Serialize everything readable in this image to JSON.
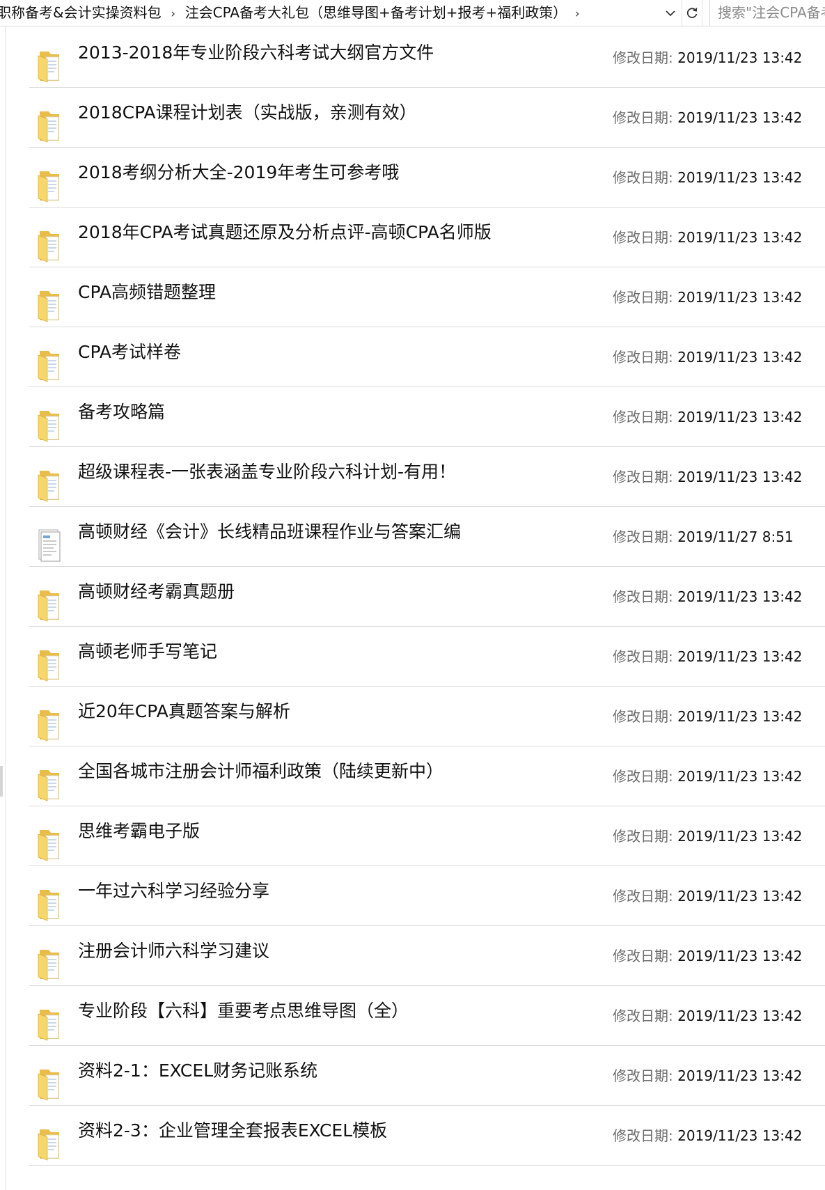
{
  "address_bar": {
    "breadcrumb": [
      "职称备考&会计实操资料包",
      "注会CPA备考大礼包（思维导图+备考计划+报考+福利政策）"
    ],
    "search_placeholder": "搜索\"注会CPA备考大礼包\""
  },
  "date_label": "修改日期: ",
  "icons": {
    "folder": "folder-icon",
    "document": "document-icon",
    "separator": "chevron-right-icon",
    "dropdown": "chevron-down-icon",
    "refresh": "refresh-icon"
  },
  "colors": {
    "folder_front": "#f7d769",
    "folder_back": "#e9bd4c",
    "paper": "#ffffff",
    "row_divider": "#dadada",
    "label_gray": "#6b6b6b"
  },
  "files": [
    {
      "name": "2013-2018年专业阶段六科考试大纲官方文件",
      "date": "2019/11/23 13:42",
      "icon": "folder"
    },
    {
      "name": "2018CPA课程计划表（实战版，亲测有效）",
      "date": "2019/11/23 13:42",
      "icon": "folder"
    },
    {
      "name": "2018考纲分析大全-2019年考生可参考哦",
      "date": "2019/11/23 13:42",
      "icon": "folder"
    },
    {
      "name": "2018年CPA考试真题还原及分析点评-高顿CPA名师版",
      "date": "2019/11/23 13:42",
      "icon": "folder"
    },
    {
      "name": "CPA高频错题整理",
      "date": "2019/11/23 13:42",
      "icon": "folder"
    },
    {
      "name": "CPA考试样卷",
      "date": "2019/11/23 13:42",
      "icon": "folder"
    },
    {
      "name": "备考攻略篇",
      "date": "2019/11/23 13:42",
      "icon": "folder"
    },
    {
      "name": "超级课程表-一张表涵盖专业阶段六科计划-有用！",
      "date": "2019/11/23 13:42",
      "icon": "folder"
    },
    {
      "name": "高顿财经《会计》长线精品班课程作业与答案汇编",
      "date": "2019/11/27 8:51",
      "icon": "document"
    },
    {
      "name": "高顿财经考霸真题册",
      "date": "2019/11/23 13:42",
      "icon": "folder"
    },
    {
      "name": "高顿老师手写笔记",
      "date": "2019/11/23 13:42",
      "icon": "folder"
    },
    {
      "name": "近20年CPA真题答案与解析",
      "date": "2019/11/23 13:42",
      "icon": "folder"
    },
    {
      "name": "全国各城市注册会计师福利政策（陆续更新中）",
      "date": "2019/11/23 13:42",
      "icon": "folder"
    },
    {
      "name": "思维考霸电子版",
      "date": "2019/11/23 13:42",
      "icon": "folder"
    },
    {
      "name": "一年过六科学习经验分享",
      "date": "2019/11/23 13:42",
      "icon": "folder"
    },
    {
      "name": "注册会计师六科学习建议",
      "date": "2019/11/23 13:42",
      "icon": "folder"
    },
    {
      "name": "专业阶段【六科】重要考点思维导图（全）",
      "date": "2019/11/23 13:42",
      "icon": "folder"
    },
    {
      "name": "资料2-1：EXCEL财务记账系统",
      "date": "2019/11/23 13:42",
      "icon": "folder"
    },
    {
      "name": "资料2-3：企业管理全套报表EXCEL模板",
      "date": "2019/11/23 13:42",
      "icon": "folder"
    }
  ]
}
